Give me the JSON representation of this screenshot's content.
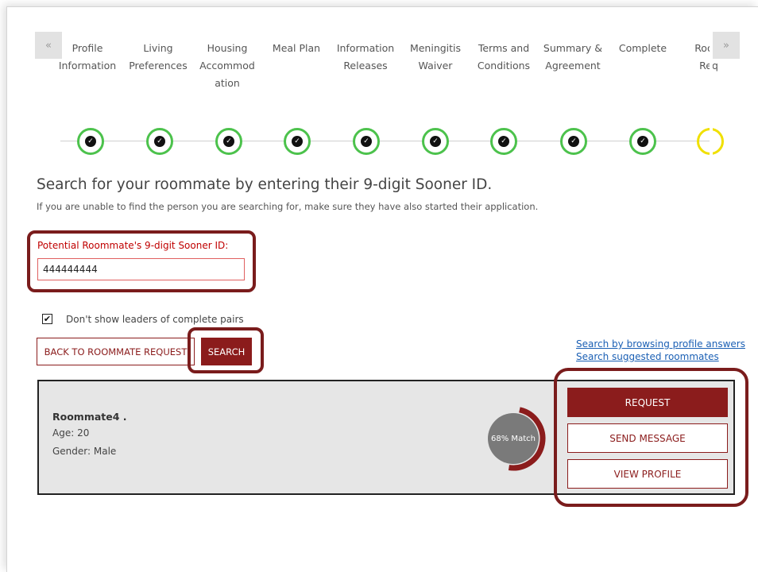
{
  "nav": {
    "prev_icon": "«",
    "next_icon": "»"
  },
  "steps": [
    {
      "label": "Profile Information",
      "status": "complete"
    },
    {
      "label": "Living Preferences",
      "status": "complete"
    },
    {
      "label": "Housing Accommod ation",
      "status": "complete"
    },
    {
      "label": "Meal Plan",
      "status": "complete"
    },
    {
      "label": "Information Releases",
      "status": "complete"
    },
    {
      "label": "Meningitis Waiver",
      "status": "complete"
    },
    {
      "label": "Terms and Conditions",
      "status": "complete"
    },
    {
      "label": "Summary & Agreement",
      "status": "complete"
    },
    {
      "label": "Complete",
      "status": "complete"
    },
    {
      "label": "Roommate Req",
      "status": "current"
    }
  ],
  "step_labels_display": {
    "s0": "Profile\nInformation",
    "s1": "Living\nPreferences",
    "s2": "Housing\nAccommod\nation",
    "s3": "Meal Plan",
    "s4": "Information\nReleases",
    "s5": "Meningitis\nWaiver",
    "s6": "Terms and\nConditions",
    "s7": "Summary &\nAgreement",
    "s8": "Complete",
    "s9": "Room\nReq"
  },
  "check_icon": "✓",
  "search": {
    "heading": "Search for your roommate by entering their 9-digit Sooner ID.",
    "subtext": "If you are unable to find the person you are searching for, make sure they have also started their application.",
    "id_label": "Potential Roommate's 9-digit Sooner ID:",
    "id_value": "444444444",
    "checkbox_checked": true,
    "checkbox_mark": "✔",
    "checkbox_label": "Don't show leaders of complete pairs",
    "back_button": "BACK TO ROOMMATE REQUEST",
    "search_button": "SEARCH",
    "link_browse": "Search by browsing profile answers",
    "link_suggested": "Search suggested roommates"
  },
  "result": {
    "name": "Roommate4 .",
    "age": "Age: 20",
    "gender": "Gender: Male",
    "match_label": "68% Match",
    "match_percent": 68,
    "request_button": "REQUEST",
    "message_button": "SEND MESSAGE",
    "profile_button": "VIEW PROFILE"
  },
  "colors": {
    "brand": "#8b1c1c",
    "check_green": "#4cc24c",
    "current_yellow": "#f0e000",
    "match_gray": "#7a7a7a",
    "highlight": "#7a1c1c",
    "link": "#1a5fb4"
  }
}
